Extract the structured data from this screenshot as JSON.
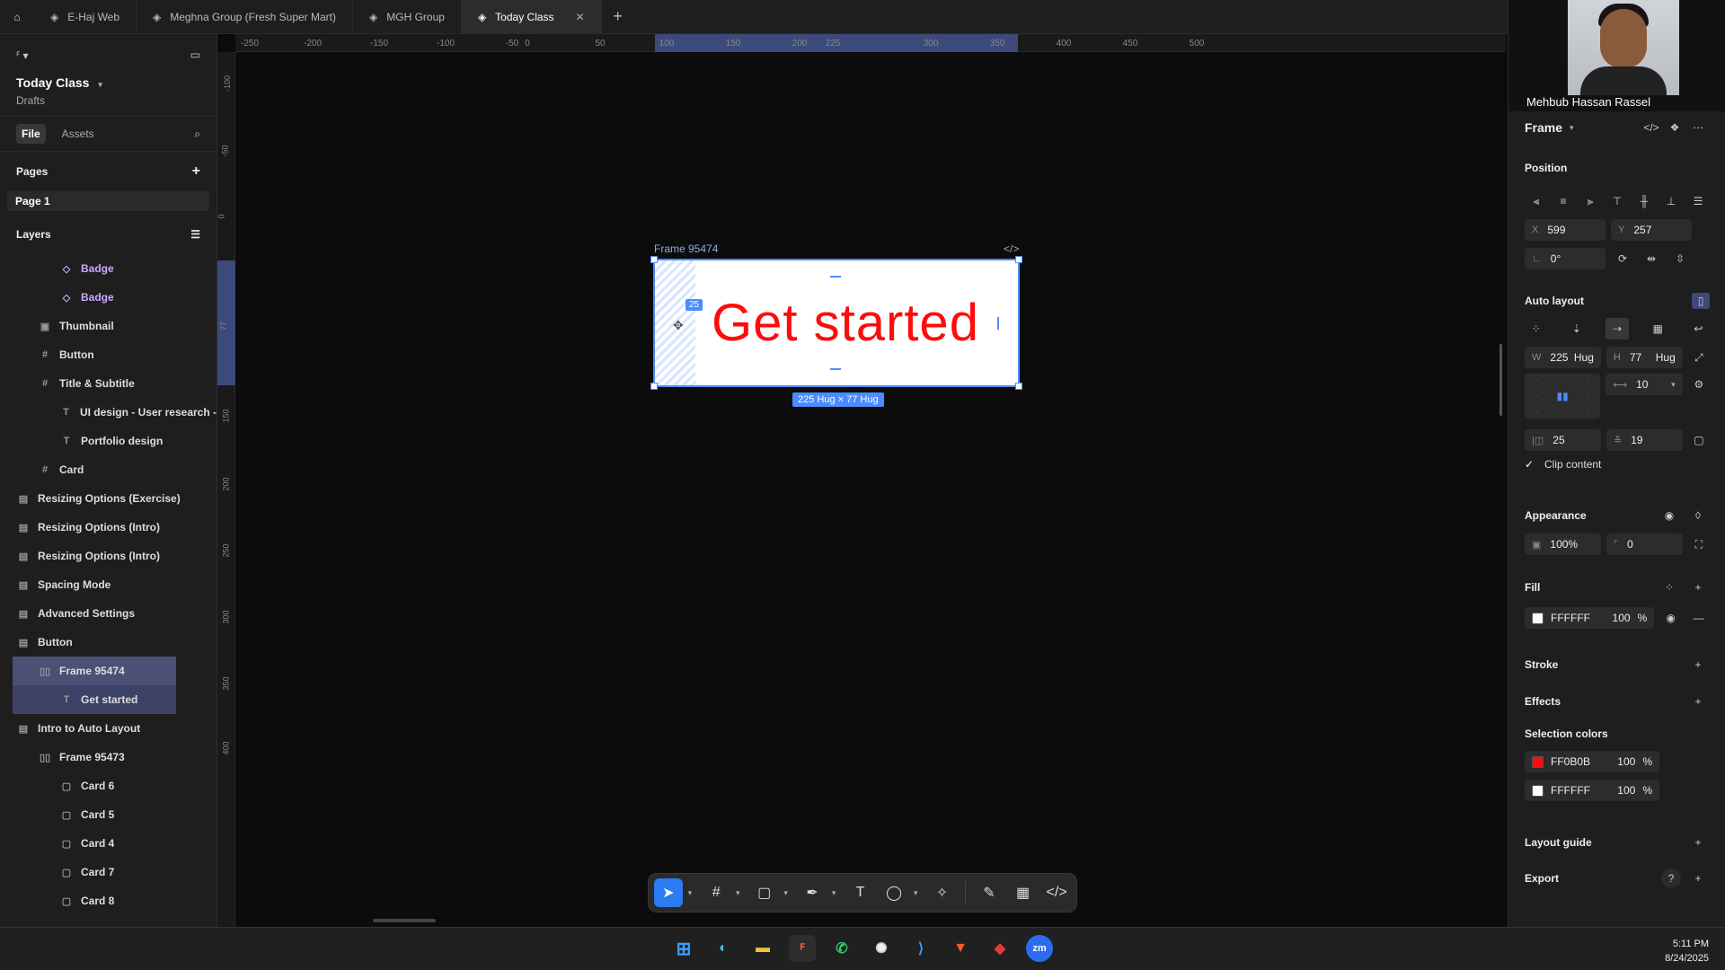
{
  "tabs": [
    {
      "label": "E-Haj Web"
    },
    {
      "label": "Meghna Group (Fresh Super Mart)"
    },
    {
      "label": "MGH Group"
    },
    {
      "label": "Today Class",
      "active": true
    }
  ],
  "project": {
    "name": "Today Class",
    "location": "Drafts"
  },
  "left_tabs": {
    "file": "File",
    "assets": "Assets"
  },
  "pages": {
    "title": "Pages",
    "items": [
      "Page 1"
    ]
  },
  "layers": {
    "title": "Layers",
    "items": [
      {
        "label": "Badge",
        "icon": "component-icon",
        "indent": 2
      },
      {
        "label": "Badge",
        "icon": "component-icon",
        "indent": 2
      },
      {
        "label": "Thumbnail",
        "icon": "image-icon",
        "indent": 1
      },
      {
        "label": "Button",
        "icon": "frame-icon",
        "indent": 1
      },
      {
        "label": "Title & Subtitle",
        "icon": "frame-icon",
        "indent": 1
      },
      {
        "label": "UI design - User research - F",
        "icon": "text-icon",
        "indent": 2
      },
      {
        "label": "Portfolio design",
        "icon": "text-icon",
        "indent": 2
      },
      {
        "label": "Card",
        "icon": "frame-icon",
        "indent": 1
      },
      {
        "label": "Resizing Options (Exercise)",
        "icon": "section-icon",
        "indent": 0
      },
      {
        "label": "Resizing Options (Intro)",
        "icon": "section-icon",
        "indent": 0
      },
      {
        "label": "Resizing Options (Intro)",
        "icon": "section-icon",
        "indent": 0
      },
      {
        "label": "Spacing Mode",
        "icon": "section-icon",
        "indent": 0
      },
      {
        "label": "Advanced Settings",
        "icon": "section-icon",
        "indent": 0
      },
      {
        "label": "Button",
        "icon": "section-icon",
        "indent": 0
      },
      {
        "label": "Frame 95474",
        "icon": "autolayout-icon",
        "indent": 1,
        "selected": true
      },
      {
        "label": "Get started",
        "icon": "text-icon",
        "indent": 2,
        "selected": true
      },
      {
        "label": "Intro to Auto Layout",
        "icon": "section-icon",
        "indent": 0
      },
      {
        "label": "Frame 95473",
        "icon": "autolayout-icon",
        "indent": 1
      },
      {
        "label": "Card 6",
        "icon": "rect-icon",
        "indent": 2
      },
      {
        "label": "Card 5",
        "icon": "rect-icon",
        "indent": 2
      },
      {
        "label": "Card 4",
        "icon": "rect-icon",
        "indent": 2
      },
      {
        "label": "Card 7",
        "icon": "rect-icon",
        "indent": 2
      },
      {
        "label": "Card 8",
        "icon": "rect-icon",
        "indent": 2
      }
    ]
  },
  "ruler_top": [
    "-250",
    "-200",
    "-150",
    "-100",
    "-50",
    "0",
    "50",
    "100",
    "150",
    "200",
    "225",
    "300",
    "350",
    "400",
    "450",
    "500"
  ],
  "ruler_left": [
    "-100",
    "-50",
    "0",
    "77",
    "150",
    "200",
    "250",
    "300",
    "350",
    "400"
  ],
  "canvas": {
    "frame_name": "Frame 95474",
    "frame_text": "Get started",
    "text_color": "#FF0B0B",
    "padding_badge": "25",
    "size_badge": "225 Hug × 77 Hug"
  },
  "video": {
    "name": "Mehbub Hassan Rassel"
  },
  "design": {
    "header": "Frame",
    "position": {
      "title": "Position",
      "x": "599",
      "y": "257",
      "rotation": "0°"
    },
    "auto_layout": {
      "title": "Auto layout",
      "w": "225",
      "w_mode": "Hug",
      "h": "77",
      "h_mode": "Hug",
      "gap": "10",
      "pad_h": "25",
      "pad_v": "19",
      "clip": "Clip content"
    },
    "appearance": {
      "title": "Appearance",
      "opacity": "100%",
      "radius": "0"
    },
    "fill": {
      "title": "Fill",
      "color": "FFFFFF",
      "opacity": "100",
      "unit": "%"
    },
    "stroke": {
      "title": "Stroke"
    },
    "effects": {
      "title": "Effects"
    },
    "selection_colors": {
      "title": "Selection colors",
      "items": [
        {
          "hex": "FF0B0B",
          "swatch": "#FF0B0B",
          "opacity": "100",
          "unit": "%"
        },
        {
          "hex": "FFFFFF",
          "swatch": "#FFFFFF",
          "opacity": "100",
          "unit": "%"
        }
      ]
    },
    "layout_guide": {
      "title": "Layout guide"
    },
    "export": {
      "title": "Export"
    }
  },
  "accent": "#4A8CFF",
  "clock": {
    "time": "5:11 PM",
    "date": "8/24/2025"
  }
}
